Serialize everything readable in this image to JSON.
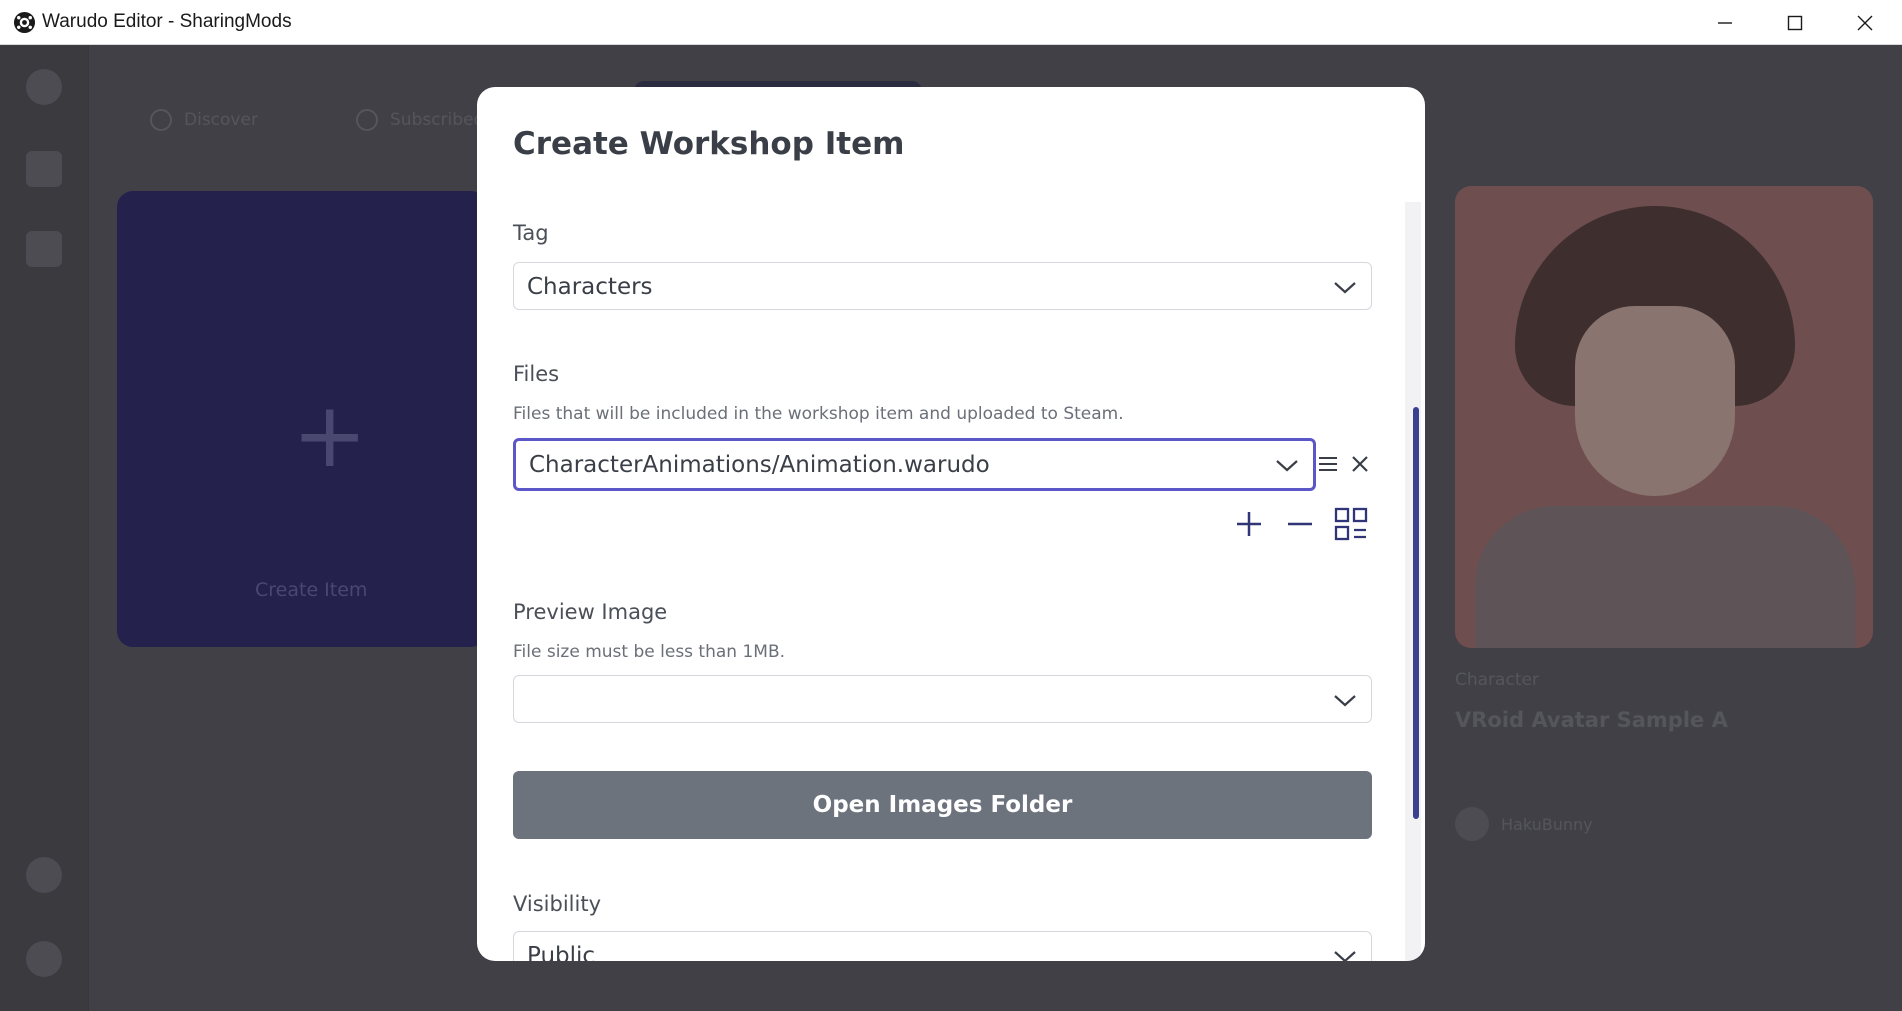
{
  "window": {
    "title": "Warudo Editor - SharingMods",
    "app_icon": "warudo-logo-icon",
    "controls": [
      "minimize-icon",
      "maximize-icon",
      "close-icon"
    ]
  },
  "background": {
    "tabs": [
      "Discover",
      "Subscribed"
    ],
    "create_card_label": "Create Item",
    "item_card": {
      "tag": "Character",
      "title": "VRoid Avatar Sample A",
      "author": "HakuBunny"
    }
  },
  "modal": {
    "title": "Create Workshop Item",
    "tag": {
      "label": "Tag",
      "value": "Characters"
    },
    "files": {
      "label": "Files",
      "hint": "Files that will be included in the workshop item and uploaded to Steam.",
      "entries": [
        "CharacterAnimations/Animation.warudo"
      ],
      "row_actions": [
        "reorder-icon",
        "remove-icon"
      ],
      "list_actions": [
        "add-icon",
        "minus-icon",
        "grid-list-icon"
      ]
    },
    "preview_image": {
      "label": "Preview Image",
      "hint": "File size must be less than 1MB.",
      "value": ""
    },
    "open_images_button": "Open Images Folder",
    "visibility": {
      "label": "Visibility",
      "value": "Public"
    }
  },
  "colors": {
    "accent": "#5b57c9",
    "button_bg": "#6c737d",
    "scrollbar": "#3b3f8f"
  }
}
